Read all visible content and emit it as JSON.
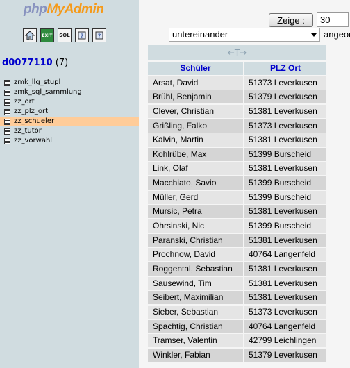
{
  "logo": {
    "php": "php",
    "my": "My",
    "admin": "Admin"
  },
  "nav_icons": [
    "home-icon",
    "sql-query-icon",
    "sql-window-icon",
    "docs-icon",
    "docs-sql-icon"
  ],
  "nav_icon_text": {
    "sql1": "EXIT",
    "sql2": "SQL"
  },
  "database": {
    "name": "d0077110",
    "count": "(7)"
  },
  "tables": [
    {
      "name": "zmk_llg_stupl",
      "active": false
    },
    {
      "name": "zmk_sql_sammlung",
      "active": false
    },
    {
      "name": "zz_ort",
      "active": false
    },
    {
      "name": "zz_plz_ort",
      "active": false
    },
    {
      "name": "zz_schueler",
      "active": true
    },
    {
      "name": "zz_tutor",
      "active": false
    },
    {
      "name": "zz_vorwahl",
      "active": false
    }
  ],
  "controls": {
    "show_button": "Zeige :",
    "show_count": "30",
    "display_mode": "untereinander",
    "mode_label": "angeor"
  },
  "results": {
    "arrow_glyph": "←T→",
    "columns": [
      "Schüler",
      "PLZ Ort"
    ],
    "rows": [
      [
        "Arsat, David",
        "51373 Leverkusen"
      ],
      [
        "Brühl, Benjamin",
        "51379 Leverkusen"
      ],
      [
        "Clever, Christian",
        "51381 Leverkusen"
      ],
      [
        "Grißling, Falko",
        "51373 Leverkusen"
      ],
      [
        "Kalvin, Martin",
        "51381 Leverkusen"
      ],
      [
        "Kohlrübe, Max",
        "51399 Burscheid"
      ],
      [
        "Link, Olaf",
        "51381 Leverkusen"
      ],
      [
        "Macchiato, Savio",
        "51399 Burscheid"
      ],
      [
        "Müller, Gerd",
        "51399 Burscheid"
      ],
      [
        "Mursic, Petra",
        "51381 Leverkusen"
      ],
      [
        "Ohrsinski, Nic",
        "51399 Burscheid"
      ],
      [
        "Paranski, Christian",
        "51381 Leverkusen"
      ],
      [
        "Prochnow, David",
        "40764 Langenfeld"
      ],
      [
        "Roggental, Sebastian",
        "51381 Leverkusen"
      ],
      [
        "Sausewind, Tim",
        "51381 Leverkusen"
      ],
      [
        "Seibert, Maximilian",
        "51381 Leverkusen"
      ],
      [
        "Sieber, Sebastian",
        "51373 Leverkusen"
      ],
      [
        "Spachtig, Christian",
        "40764 Langenfeld"
      ],
      [
        "Tramser, Valentin",
        "42799 Leichlingen"
      ],
      [
        "Winkler, Fabian",
        "51379 Leverkusen"
      ]
    ]
  },
  "colors": {
    "nav_bg": "#d0dce0",
    "header_bg": "#d0dce0",
    "active_table": "#ffcc99",
    "link": "#0000cc"
  }
}
